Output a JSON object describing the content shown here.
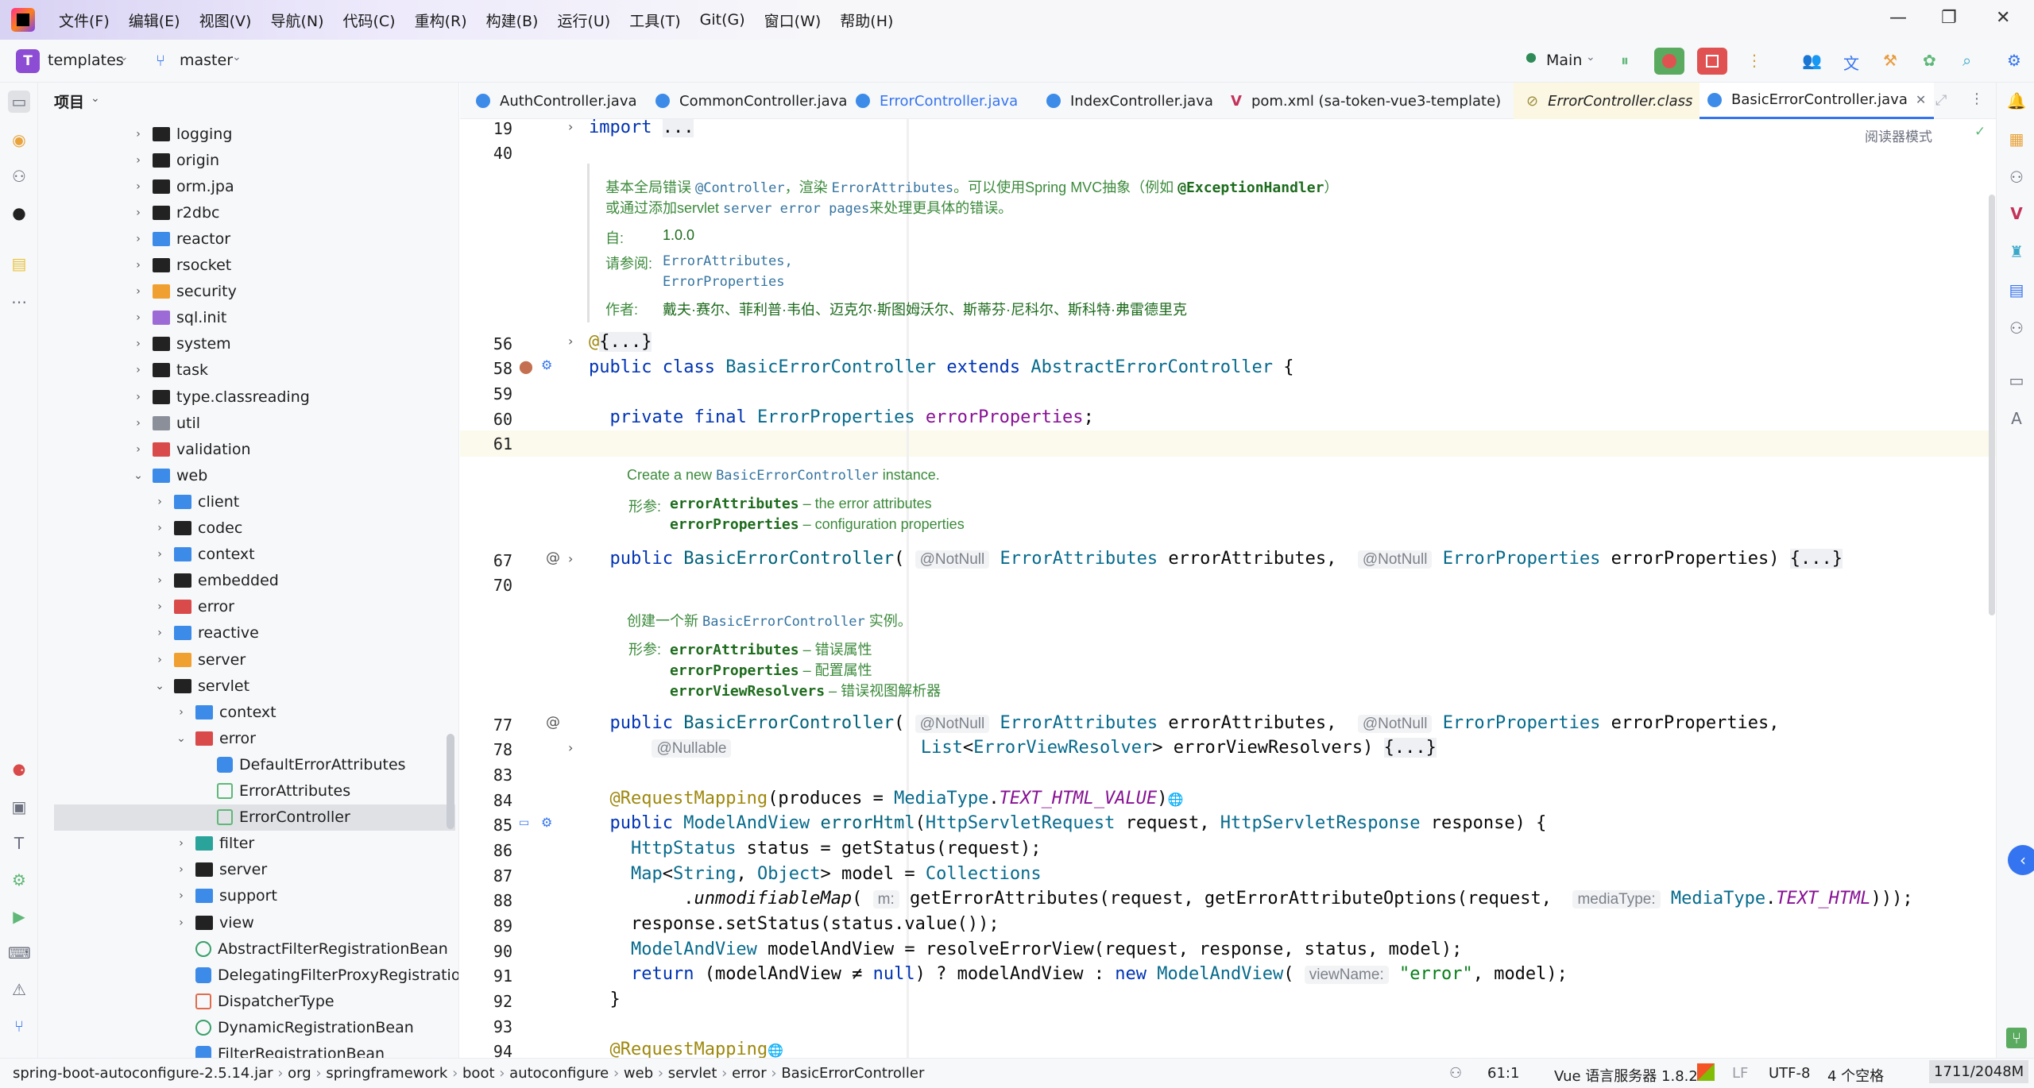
{
  "menu": [
    "文件(F)",
    "编辑(E)",
    "视图(V)",
    "导航(N)",
    "代码(C)",
    "重构(R)",
    "构建(B)",
    "运行(U)",
    "工具(T)",
    "Git(G)",
    "窗口(W)",
    "帮助(H)"
  ],
  "toolbar": {
    "project_badge": "T",
    "project": "templates",
    "branch": "master",
    "run_config": "Main"
  },
  "project_panel": {
    "title": "项目",
    "rows": [
      {
        "label": "logging",
        "depth": 0,
        "arrow": "›",
        "icon": "black"
      },
      {
        "label": "origin",
        "depth": 0,
        "arrow": "›",
        "icon": "black"
      },
      {
        "label": "orm.jpa",
        "depth": 0,
        "arrow": "›",
        "icon": "black"
      },
      {
        "label": "r2dbc",
        "depth": 0,
        "arrow": "›",
        "icon": "black"
      },
      {
        "label": "reactor",
        "depth": 0,
        "arrow": "›",
        "icon": "blue"
      },
      {
        "label": "rsocket",
        "depth": 0,
        "arrow": "›",
        "icon": "black"
      },
      {
        "label": "security",
        "depth": 0,
        "arrow": "›",
        "icon": "orange"
      },
      {
        "label": "sql.init",
        "depth": 0,
        "arrow": "›",
        "icon": "purple"
      },
      {
        "label": "system",
        "depth": 0,
        "arrow": "›",
        "icon": "black"
      },
      {
        "label": "task",
        "depth": 0,
        "arrow": "›",
        "icon": "black"
      },
      {
        "label": "type.classreading",
        "depth": 0,
        "arrow": "›",
        "icon": "black"
      },
      {
        "label": "util",
        "depth": 0,
        "arrow": "›",
        "icon": "gray"
      },
      {
        "label": "validation",
        "depth": 0,
        "arrow": "›",
        "icon": "red"
      },
      {
        "label": "web",
        "depth": 0,
        "arrow": "⌄",
        "icon": "blue"
      },
      {
        "label": "client",
        "depth": 1,
        "arrow": "›",
        "icon": "blue"
      },
      {
        "label": "codec",
        "depth": 1,
        "arrow": "›",
        "icon": "black"
      },
      {
        "label": "context",
        "depth": 1,
        "arrow": "›",
        "icon": "blue"
      },
      {
        "label": "embedded",
        "depth": 1,
        "arrow": "›",
        "icon": "black"
      },
      {
        "label": "error",
        "depth": 1,
        "arrow": "›",
        "icon": "red"
      },
      {
        "label": "reactive",
        "depth": 1,
        "arrow": "›",
        "icon": "blue"
      },
      {
        "label": "server",
        "depth": 1,
        "arrow": "›",
        "icon": "orange"
      },
      {
        "label": "servlet",
        "depth": 1,
        "arrow": "⌄",
        "icon": "black"
      },
      {
        "label": "context",
        "depth": 2,
        "arrow": "›",
        "icon": "blue"
      },
      {
        "label": "error",
        "depth": 2,
        "arrow": "⌄",
        "icon": "red"
      },
      {
        "label": "DefaultErrorAttributes",
        "depth": 3,
        "arrow": "",
        "icon": "class"
      },
      {
        "label": "ErrorAttributes",
        "depth": 3,
        "arrow": "",
        "icon": "iface"
      },
      {
        "label": "ErrorController",
        "depth": 3,
        "arrow": "",
        "icon": "iface",
        "selected": true
      },
      {
        "label": "filter",
        "depth": 2,
        "arrow": "›",
        "icon": "teal"
      },
      {
        "label": "server",
        "depth": 2,
        "arrow": "›",
        "icon": "black"
      },
      {
        "label": "support",
        "depth": 2,
        "arrow": "›",
        "icon": "blue"
      },
      {
        "label": "view",
        "depth": 2,
        "arrow": "›",
        "icon": "black"
      },
      {
        "label": "AbstractFilterRegistrationBean",
        "depth": 2,
        "arrow": "",
        "icon": "abstract"
      },
      {
        "label": "DelegatingFilterProxyRegistrationBean",
        "depth": 2,
        "arrow": "",
        "icon": "class"
      },
      {
        "label": "DispatcherType",
        "depth": 2,
        "arrow": "",
        "icon": "enum"
      },
      {
        "label": "DynamicRegistrationBean",
        "depth": 2,
        "arrow": "",
        "icon": "abstract"
      },
      {
        "label": "FilterRegistrationBean",
        "depth": 2,
        "arrow": "",
        "icon": "class"
      }
    ]
  },
  "tabs": [
    {
      "label": "AuthController.java",
      "color": "#1e1e1e"
    },
    {
      "label": "CommonController.java",
      "color": "#1e1e1e"
    },
    {
      "label": "ErrorController.java",
      "color": "#3574f0"
    },
    {
      "label": "IndexController.java",
      "color": "#1e1e1e"
    },
    {
      "label": "pom.xml (sa-token-vue3-template)",
      "color": "#1e1e1e"
    },
    {
      "label": "ErrorController.class",
      "color": "#1e1e1e"
    },
    {
      "label": "BasicErrorController.java",
      "color": "#1e1e1e"
    }
  ],
  "editor": {
    "reader_mode": "阅读器模式",
    "line_numbers": [
      "19",
      "40",
      "56",
      "58",
      "59",
      "60",
      "61",
      "67",
      "70",
      "77",
      "78",
      "83",
      "84",
      "85",
      "86",
      "87",
      "88",
      "89",
      "90",
      "91",
      "92",
      "93",
      "94"
    ],
    "doc1": {
      "line1_a": "基本全局错误 ",
      "line1_m1": "@Controller",
      "line1_b": "，渲染 ",
      "line1_m2": "ErrorAttributes",
      "line1_c": "。可以使用Spring MVC抽象（例如 ",
      "line1_m3": "@ExceptionHandler",
      "line1_d": "）",
      "line2_a": "或通过添加servlet ",
      "line2_m": "server error pages",
      "line2_b": "来处理更具体的错误。",
      "since_label": "自:",
      "since": "1.0.0",
      "see_label": "请参阅:",
      "see1": "ErrorAttributes,",
      "see2": "ErrorProperties",
      "author_label": "作者:",
      "authors": "戴夫·赛尔、菲利普·韦伯、迈克尔·斯图姆沃尔、斯蒂芬·尼科尔、斯科特·弗雷德里克"
    },
    "doc2": {
      "line1_a": "Create a new ",
      "line1_m": "BasicErrorController",
      "line1_b": " instance.",
      "param_label": "形参:",
      "p1": "errorAttributes",
      "p1d": " – the error attributes",
      "p2": "errorProperties",
      "p2d": " – configuration properties"
    },
    "doc3": {
      "line1_a": "创建一个新 ",
      "line1_m": "BasicErrorController",
      "line1_b": " 实例。",
      "param_label": "形参:",
      "p1": "errorAttributes",
      "p1d": " – 错误属性",
      "p2": "errorProperties",
      "p2d": " – 配置属性",
      "p3": "errorViewResolvers",
      "p3d": " – 错误视图解析器"
    },
    "hints": {
      "notnull": "@NotNull",
      "nullable": "@Nullable",
      "m": "m:",
      "mediaType": "mediaType:",
      "viewName": "viewName:"
    }
  },
  "statusbar": {
    "breadcrumb": [
      "spring-boot-autoconfigure-2.5.14.jar",
      "org",
      "springframework",
      "boot",
      "autoconfigure",
      "web",
      "servlet",
      "error",
      "BasicErrorController"
    ],
    "position": "61:1",
    "lang_server": "Vue 语言服务器 1.8.24",
    "line_sep": "LF",
    "encoding": "UTF-8",
    "indent": "4 个空格",
    "memory": "1711/2048M"
  }
}
